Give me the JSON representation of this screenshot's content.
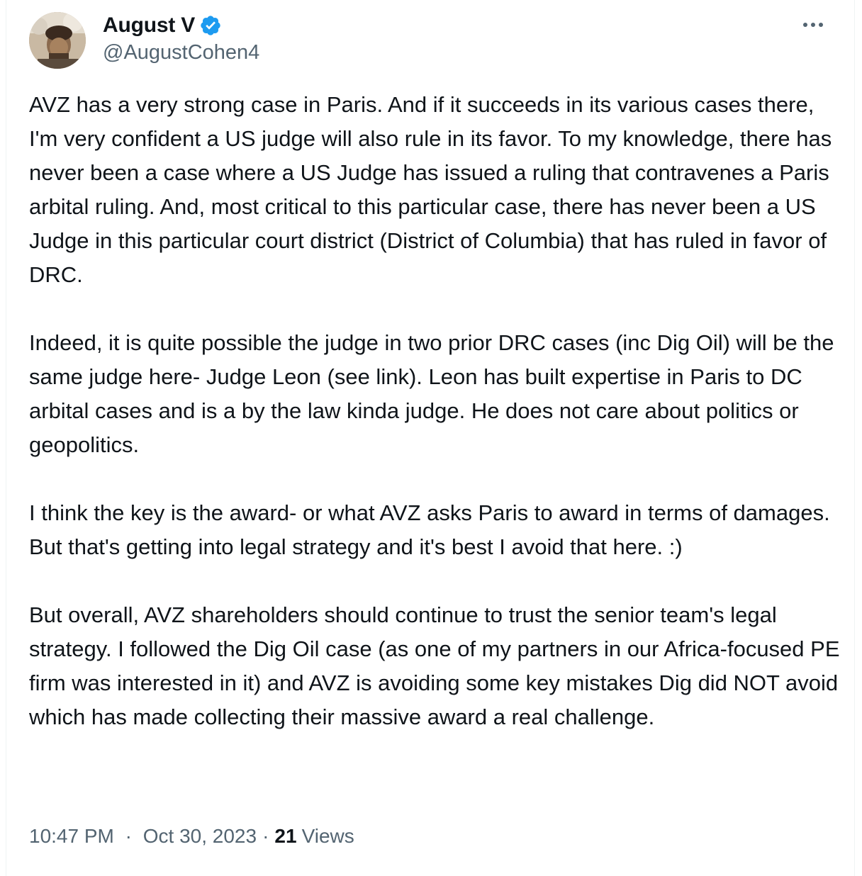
{
  "author": {
    "display_name": "August V",
    "handle": "@AugustCohen4",
    "avatar_icon": "user-avatar",
    "verified_icon": "verified-badge-icon",
    "verified_color": "#1d9bf0"
  },
  "menu": {
    "more_icon": "more-horizontal-icon"
  },
  "tweet": {
    "paragraphs": [
      "AVZ has a very strong case in Paris. And if it succeeds in its various cases there, I'm very confident a US judge will also rule in its favor. To my knowledge, there has never been a case where a US Judge has issued a ruling that contravenes a Paris arbital ruling. And, most critical to this particular case, there has never been a US Judge in this particular court district (District of Columbia) that has ruled in favor of DRC.",
      "Indeed, it is quite possible the judge in two prior DRC cases (inc Dig Oil) will be the same judge here- Judge Leon (see link). Leon has built expertise in Paris to DC arbital cases and is a by the law kinda judge. He does not care about politics or geopolitics.",
      "I think the key is the award- or what AVZ asks Paris to award in terms of damages. But that's getting into legal strategy and it's best I avoid that here. :)",
      "But overall, AVZ shareholders should continue to trust the senior team's legal strategy. I followed the Dig Oil case (as one of my partners in our Africa-focused PE firm was interested in it) and AVZ is avoiding some key mistakes Dig did NOT avoid which has made collecting their massive award a real challenge."
    ]
  },
  "meta": {
    "time": "10:47 PM",
    "separator": "·",
    "date": "Oct 30, 2023",
    "views_count": "21",
    "views_label": "Views"
  }
}
